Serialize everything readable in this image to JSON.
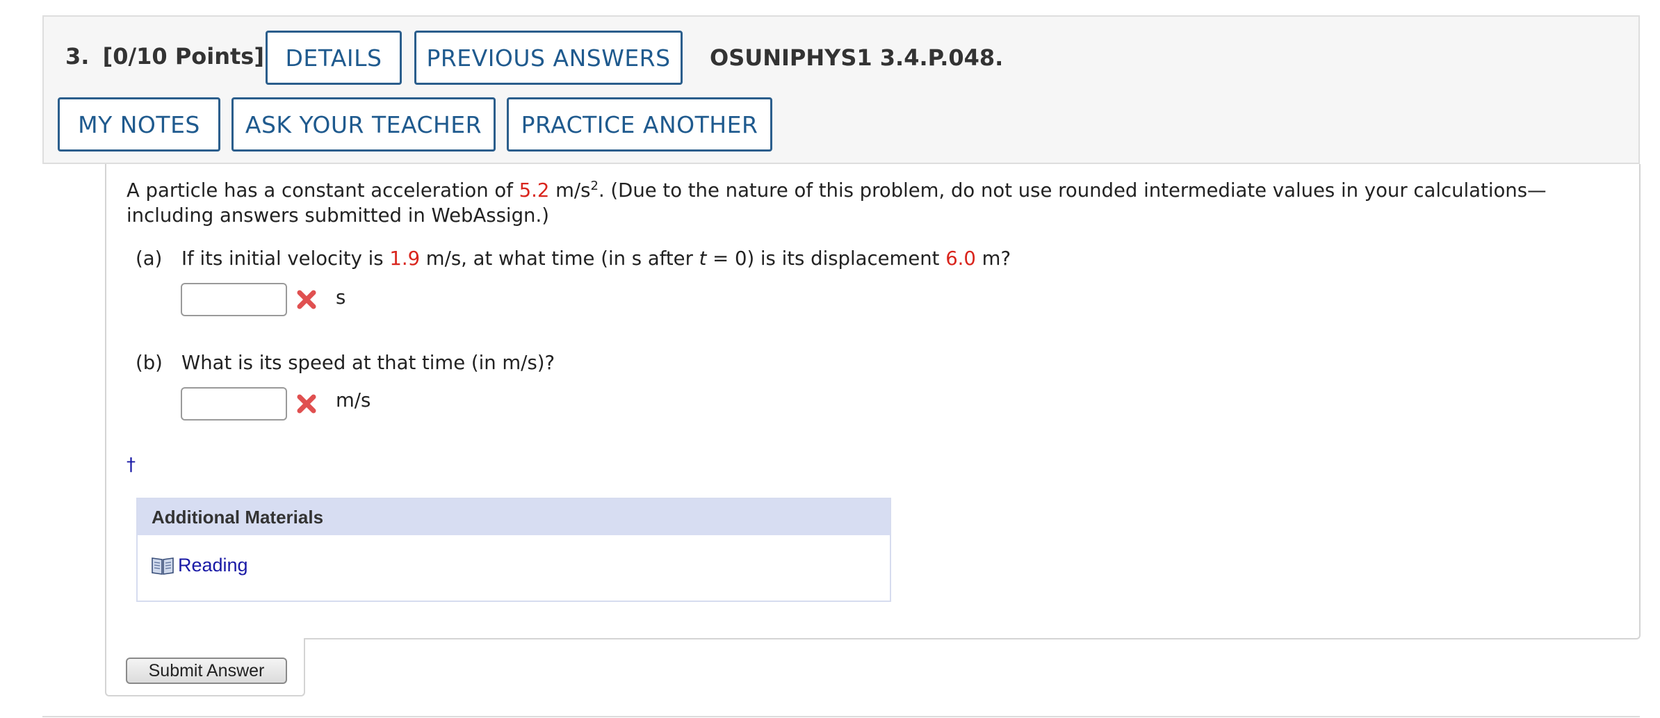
{
  "header": {
    "question_number": "3.",
    "points": "[0/10 Points]",
    "problem_code": "OSUNIPHYS1 3.4.P.048.",
    "buttons": {
      "details": "DETAILS",
      "previous_answers": "PREVIOUS ANSWERS",
      "my_notes": "MY NOTES",
      "ask_teacher": "ASK YOUR TEACHER",
      "practice_another": "PRACTICE ANOTHER"
    }
  },
  "question": {
    "intro": {
      "prefix": "A particle has a constant acceleration of ",
      "acceleration_value": "5.2",
      "acceleration_unit": " m/s",
      "exponent": "2",
      "suffix": ". (Due to the nature of this problem, do not use rounded intermediate values in your calculations—including answers submitted in WebAssign.)"
    },
    "part_a": {
      "label": "(a)",
      "text_1": "If its initial velocity is ",
      "velocity_value": "1.9",
      "text_2": " m/s, at what time (in s after ",
      "variable": "t",
      "text_3": " = 0) is its displacement ",
      "displacement_value": "6.0",
      "text_4": " m?",
      "input_value": "",
      "status": "incorrect",
      "unit": "s"
    },
    "part_b": {
      "label": "(b)",
      "text": "What is its speed at that time (in m/s)?",
      "input_value": "",
      "status": "incorrect",
      "unit": "m/s"
    },
    "footnote_marker": "†"
  },
  "additional_materials": {
    "title": "Additional Materials",
    "link_icon": "book-icon",
    "link_label": "Reading"
  },
  "submit": {
    "label": "Submit Answer"
  },
  "colors": {
    "button_border": "#2b5e8c",
    "button_text": "#1f5a8e",
    "value_red": "#d9251d",
    "link_blue": "#1a1aa6",
    "materials_header_bg": "#d7ddf2",
    "incorrect_mark": "#e05050"
  }
}
